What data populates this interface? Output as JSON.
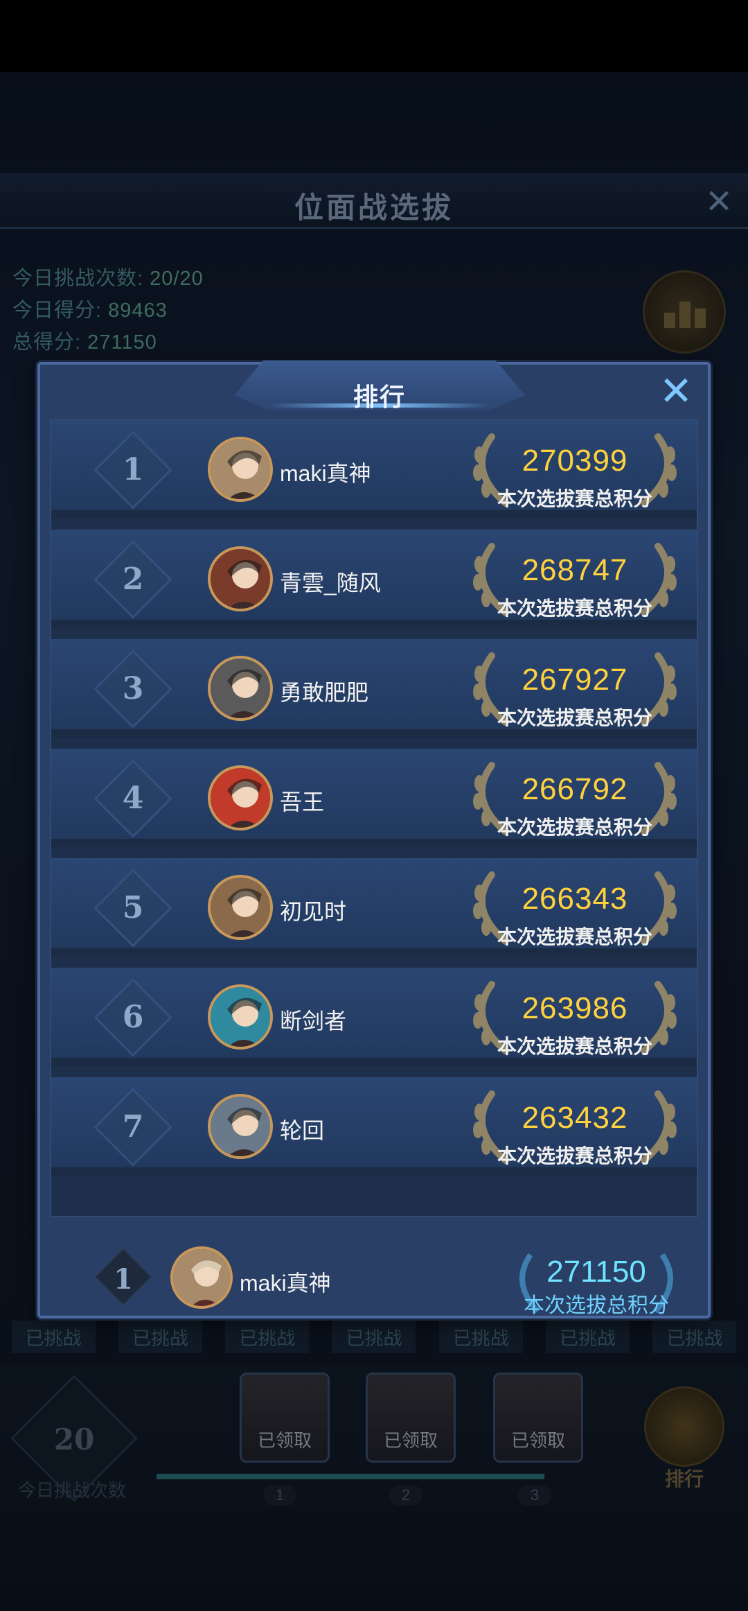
{
  "background": {
    "title": "位面战选拔",
    "stats": [
      {
        "label": "今日挑战次数:",
        "value": "20/20"
      },
      {
        "label": "今日得分:",
        "value": "89463"
      },
      {
        "label": "总得分:",
        "value": "271150"
      }
    ],
    "challenged_labels": [
      "已挑战",
      "已挑战",
      "已挑战",
      "已挑战",
      "已挑战",
      "已挑战",
      "已挑战"
    ],
    "challenge_count": "20",
    "challenge_count_label": "今日挑战次数",
    "chests": [
      {
        "label": "已领取",
        "step": "1"
      },
      {
        "label": "已领取",
        "step": "2"
      },
      {
        "label": "已领取",
        "step": "3"
      }
    ],
    "rank_button_label": "排行",
    "side_button_label": "排行"
  },
  "modal": {
    "title": "排行",
    "close_icon": "close-icon",
    "score_label": "本次选拔赛总积分",
    "entries": [
      {
        "rank": "1",
        "name": "maki真神",
        "score": "270399",
        "avatar_color": "#a78b6a"
      },
      {
        "rank": "2",
        "name": "青雲_随风",
        "score": "268747",
        "avatar_color": "#7a3b2a"
      },
      {
        "rank": "3",
        "name": "勇敢肥肥",
        "score": "267927",
        "avatar_color": "#5a5a5a"
      },
      {
        "rank": "4",
        "name": "吾王",
        "score": "266792",
        "avatar_color": "#c23a2a"
      },
      {
        "rank": "5",
        "name": "初见时",
        "score": "266343",
        "avatar_color": "#8a6a4a"
      },
      {
        "rank": "6",
        "name": "断剑者",
        "score": "263986",
        "avatar_color": "#2f8aa0"
      },
      {
        "rank": "7",
        "name": "轮回",
        "score": "263432",
        "avatar_color": "#6a7a8a"
      }
    ],
    "me": {
      "rank": "1",
      "name": "maki真神",
      "score": "271150",
      "score_label": "本次选拔总积分"
    }
  },
  "colors": {
    "score_gold": "#ffd23d",
    "my_score_cyan": "#6fe3ff",
    "panel_blue": "#2a3f66"
  }
}
